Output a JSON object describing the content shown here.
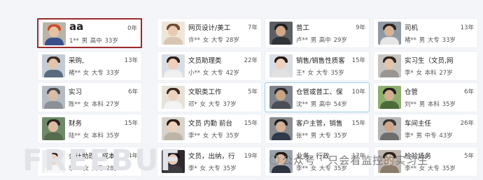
{
  "candidates": [
    {
      "title": "aa",
      "years": "0年",
      "info": "1** 男 高中 33岁",
      "selected": "red",
      "big": true,
      "avatar": {
        "bg": "#b9b3a8",
        "skin": "#e8c2a0",
        "hair": "#c94a2a",
        "shirt": "#3a4e8a"
      }
    },
    {
      "title": "网页设计/美工",
      "years": "7年",
      "info": "许** 女 大专 28岁",
      "avatar": {
        "bg": "#efe6da",
        "skin": "#e9cbb3",
        "hair": "#6d4b33",
        "shirt": "#d8c6b2"
      }
    },
    {
      "title": "普工",
      "years": "9年",
      "info": "卢** 男 高中 29岁",
      "avatar": {
        "bg": "#5b5f63",
        "skin": "#d2a787",
        "hair": "#1f1f1f",
        "shirt": "#2f3236"
      }
    },
    {
      "title": "司机",
      "years": "13年",
      "info": "褚** 男 大专 33岁",
      "avatar": {
        "bg": "#8f9aa5",
        "skin": "#d6b297",
        "hair": "#2a2522",
        "shirt": "#e6e6e6"
      }
    },
    {
      "title": "采购,",
      "years": "13年",
      "info": "褚** 女 大专 33岁",
      "avatar": {
        "bg": "#c3ccd6",
        "skin": "#e5c3a8",
        "hair": "#3a2c24",
        "shirt": "#5a6a80"
      }
    },
    {
      "title": "文员助理类",
      "years": "22年",
      "info": "小** 女 大专 42岁",
      "avatar": {
        "bg": "#dadde2",
        "skin": "#efcfba",
        "hair": "#2a1e1a",
        "shirt": "#f0f0f0"
      }
    },
    {
      "title": "销售/销售性质客",
      "years": "15年",
      "info": "王* 女 大专 35岁",
      "avatar": {
        "bg": "#d9dde4",
        "skin": "#efd0bd",
        "hair": "#20160f",
        "shirt": "#e2e2e2"
      }
    },
    {
      "title": "实习生（文员,网",
      "years": "",
      "info": "李* 女 本科 27岁",
      "avatar": {
        "bg": "#c8c5c1",
        "skin": "#e4c4aa",
        "hair": "#2b2420",
        "shirt": "#9a9590"
      }
    },
    {
      "title": "实习",
      "years": "6年",
      "info": "陈** 女 本科 27岁",
      "avatar": {
        "bg": "#b7bcc4",
        "skin": "#d9bca6",
        "hair": "#4a4a4a",
        "shirt": "#8b8f96"
      }
    },
    {
      "title": "文职类工作",
      "years": "5年",
      "info": "邓* 女 大专 37岁",
      "avatar": {
        "bg": "#e7e2d8",
        "skin": "#efd2bc",
        "hair": "#3b2a1f",
        "shirt": "#f3f3f3"
      }
    },
    {
      "title": "仓管或普工、保",
      "years": "10年",
      "info": "沈** 男 高中 54岁",
      "selected": "blue",
      "avatar": {
        "bg": "#7d838a",
        "skin": "#c9a487",
        "hair": "#2c2c2c",
        "shirt": "#4a4f55"
      }
    },
    {
      "title": "仓管",
      "years": "6年",
      "info": "刘** 男 本科 35岁",
      "avatar": {
        "bg": "#8eae6e",
        "skin": "#d2ae92",
        "hair": "#23201d",
        "shirt": "#4d6a3a"
      }
    },
    {
      "title": "财务",
      "years": "15年",
      "info": "陆** 女 本科 35岁",
      "avatar": {
        "bg": "#6f8a68",
        "skin": "#dcbba2",
        "hair": "#2a2520",
        "shirt": "#576b4e"
      }
    },
    {
      "title": "文员 内勤 前台",
      "years": "15年",
      "info": "李** 女 大专 35岁",
      "avatar": {
        "bg": "#d8d3cc",
        "skin": "#efd0bb",
        "hair": "#2a1d16",
        "shirt": "#bfb4a8"
      }
    },
    {
      "title": "客户主管，销售",
      "years": "15年",
      "info": "张** 男 大专 35岁",
      "avatar": {
        "bg": "#8a8c90",
        "skin": "#d5b096",
        "hair": "#1d1d1d",
        "shirt": "#2e3a4a"
      }
    },
    {
      "title": "车间主任",
      "years": "26年",
      "info": "李* 男 中专 43岁",
      "avatar": {
        "bg": "#b6b7b4",
        "skin": "#cda68b",
        "hair": "#353535",
        "shirt": "#6e6e6e"
      }
    },
    {
      "title": "会计助理，成本",
      "years": "4年",
      "info": "李** 女 大专 28岁",
      "avatar": {
        "bg": "#eceef0",
        "skin": "#efd3c1",
        "hair": "#1a1614",
        "shirt": "#f7f7f7"
      }
    },
    {
      "title": "文员，出纳，行",
      "years": "19年",
      "info": "李* 女 大专 35岁",
      "avatar": {
        "bg": "#2c2a2e",
        "skin": "#e7c7b1",
        "hair": "#141214",
        "shirt": "#3d3a40"
      }
    },
    {
      "title": "业务，行政",
      "years": "17年",
      "info": "李** 女 大专 35岁",
      "avatar": {
        "bg": "#9aa3ad",
        "skin": "#d8b59b",
        "hair": "#1e1b19",
        "shirt": "#2c3440"
      }
    },
    {
      "title": "检验场务",
      "years": "5年",
      "info": "李** 女 大专 35岁",
      "avatar": {
        "bg": "#bdb6ad",
        "skin": "#e0c0a6",
        "hair": "#2d251f",
        "shirt": "#8c7c6c"
      }
    }
  ],
  "watermark": "公众号 · 只会看监控的实习生",
  "bg_logo": "FREEBUF"
}
